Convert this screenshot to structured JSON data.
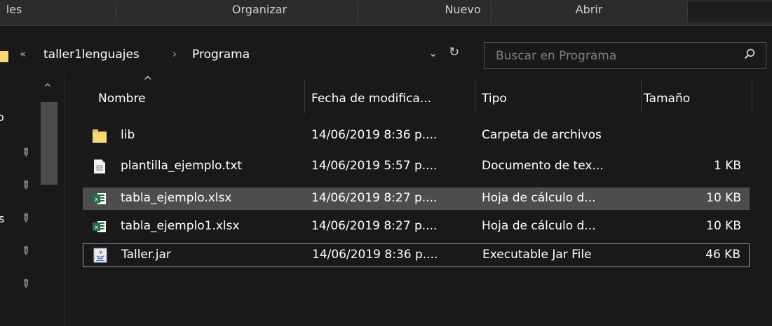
{
  "ribbon": {
    "groups": [
      "les",
      "Organizar",
      "Nuevo",
      "Abrir"
    ]
  },
  "address": {
    "overflow": "«",
    "separator": "›",
    "crumbs": [
      "taller1lenguajes",
      "Programa"
    ]
  },
  "search": {
    "placeholder": "Buscar en Programa"
  },
  "nav": {
    "partial_text": [
      "o",
      "s"
    ]
  },
  "columns": {
    "name": "Nombre",
    "date": "Fecha de modifica...",
    "type": "Tipo",
    "size": "Tamaño"
  },
  "files": [
    {
      "name": "lib",
      "date": "14/06/2019 8:36 p....",
      "type": "Carpeta de archivos",
      "size": "",
      "icon": "folder-icon"
    },
    {
      "name": "plantilla_ejemplo.txt",
      "date": "14/06/2019 5:57 p....",
      "type": "Documento de tex...",
      "size": "1 KB",
      "icon": "text-file-icon"
    },
    {
      "name": "tabla_ejemplo.xlsx",
      "date": "14/06/2019 8:27 p....",
      "type": "Hoja de cálculo d...",
      "size": "10 KB",
      "icon": "excel-file-icon"
    },
    {
      "name": "tabla_ejemplo1.xlsx",
      "date": "14/06/2019 8:27 p....",
      "type": "Hoja de cálculo d...",
      "size": "10 KB",
      "icon": "excel-file-icon"
    },
    {
      "name": "Taller.jar",
      "date": "14/06/2019 8:36 p....",
      "type": "Executable Jar File",
      "size": "46 KB",
      "icon": "java-jar-icon"
    }
  ],
  "colors": {
    "background": "#191919",
    "ribbon": "#2b2b2b",
    "hover_row": "#4d4d4d",
    "folder": "#f8d775",
    "excel_green": "#1e7145"
  }
}
